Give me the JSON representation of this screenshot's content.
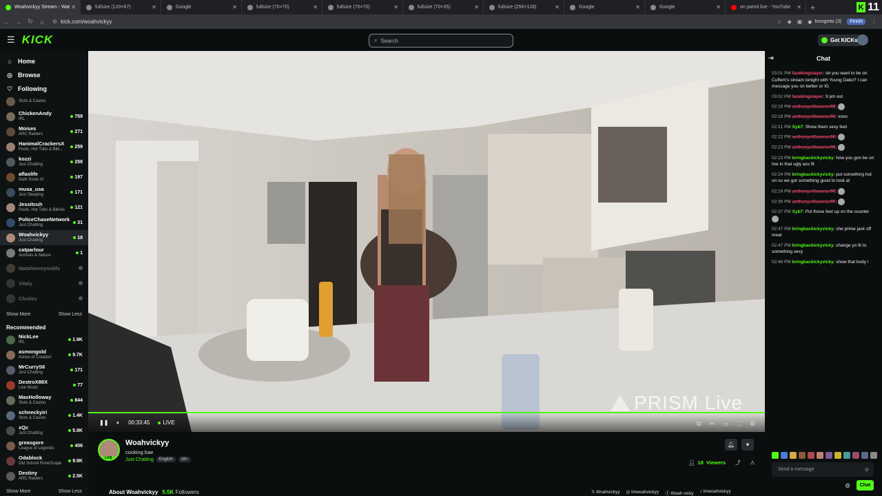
{
  "browser": {
    "tabs": [
      {
        "label": "Woahvickyy Stream - Wat",
        "color": "#53fc18",
        "active": true
      },
      {
        "label": "fullsize (120×67)",
        "color": "#888"
      },
      {
        "label": "Google",
        "color": "#888"
      },
      {
        "label": "fullsize (70×70)",
        "color": "#888"
      },
      {
        "label": "fullsize (70×70)",
        "color": "#888"
      },
      {
        "label": "fullsize (70×35)",
        "color": "#888"
      },
      {
        "label": "fullsize (256×128)",
        "color": "#888"
      },
      {
        "label": "Google",
        "color": "#888"
      },
      {
        "label": "Google",
        "color": "#888"
      },
      {
        "label": "on patrol live - YouTube",
        "color": "#ff0000"
      }
    ],
    "brand_number": "11",
    "url": "kick.com/woahvickyy",
    "incognito_label": "Incognito (3)",
    "finish_label": "Finish"
  },
  "header": {
    "logo": "KICK",
    "search_placeholder": "Search",
    "get_kicks_label": "Get KICKs"
  },
  "sidebar": {
    "nav": [
      {
        "label": "Home",
        "icon": "home-icon"
      },
      {
        "label": "Browse",
        "icon": "compass-icon"
      },
      {
        "label": "Following",
        "icon": "heart-icon"
      }
    ],
    "following": [
      {
        "name": "",
        "category": "Slots & Casino",
        "viewers": "",
        "color": "#6a5a4a"
      },
      {
        "name": "ChickenAndy",
        "category": "IRL",
        "viewers": "759",
        "color": "#7a6a5a"
      },
      {
        "name": "Moises",
        "category": "ARC Raiders",
        "viewers": "271",
        "color": "#5a4a3a"
      },
      {
        "name": "HanimalCrackersX",
        "category": "Pools, Hot Tubs & Biki...",
        "viewers": "259",
        "color": "#9a8070"
      },
      {
        "name": "kozzi",
        "category": "Just Chatting",
        "viewers": "258",
        "color": "#505a60"
      },
      {
        "name": "aflaxlife",
        "category": "Dark Souls III",
        "viewers": "197",
        "color": "#6a4a30"
      },
      {
        "name": "musa_usa",
        "category": "Just Sleeping",
        "viewers": "171",
        "color": "#3a4a5a"
      },
      {
        "name": "Jessitcuh",
        "category": "Pools, Hot Tubs & Bikinis",
        "viewers": "121",
        "color": "#a08878"
      },
      {
        "name": "PoliceChaseNetwork",
        "category": "Just Chatting",
        "viewers": "31",
        "color": "#304a6a"
      },
      {
        "name": "Woahvickyy",
        "category": "Just Chatting",
        "viewers": "18",
        "color": "#b08a78",
        "active": true
      },
      {
        "name": "catparlour",
        "category": "Animals & Nature",
        "viewers": "1",
        "color": "#7a7a7a"
      },
      {
        "name": "Natalieereynolds",
        "category": "",
        "viewers": "",
        "color": "#8a7a6a",
        "offline": true
      },
      {
        "name": "Vitaly",
        "category": "",
        "viewers": "",
        "color": "#6a6a6a",
        "offline": true
      },
      {
        "name": "Cluxles",
        "category": "",
        "viewers": "",
        "color": "#6a6a6a",
        "offline": true
      }
    ],
    "show_more": "Show More",
    "show_less": "Show Less",
    "recommended_title": "Recommended",
    "recommended": [
      {
        "name": "NickLee",
        "category": "IRL",
        "viewers": "1.9K",
        "color": "#4a6a4a"
      },
      {
        "name": "asmongold",
        "category": "Ashes of Creation",
        "viewers": "9.7K",
        "color": "#8a6a5a"
      },
      {
        "name": "MrCurryS6",
        "category": "Just Chatting",
        "viewers": "171",
        "color": "#5a5a6a"
      },
      {
        "name": "DestroX88X",
        "category": "Live Music",
        "viewers": "77",
        "color": "#9a3a2a"
      },
      {
        "name": "MaxHolloway",
        "category": "Slots & Casino",
        "viewers": "844",
        "color": "#6a6a5a"
      },
      {
        "name": "schneckyiri",
        "category": "Slots & Casino",
        "viewers": "1.4K",
        "color": "#5a6a7a"
      },
      {
        "name": "xQc",
        "category": "Just Chatting",
        "viewers": "5.9K",
        "color": "#4a4a4a"
      },
      {
        "name": "greasgore",
        "category": "League of Legends",
        "viewers": "406",
        "color": "#7a5a4a"
      },
      {
        "name": "Odablock",
        "category": "Old School RuneScape",
        "viewers": "9.9K",
        "color": "#6a3a3a"
      },
      {
        "name": "Destiny",
        "category": "ARC Raiders",
        "viewers": "2.5K",
        "color": "#5a5a5a"
      }
    ]
  },
  "player": {
    "time": "00:33:45",
    "live_label": "LIVE",
    "watermark": "PRISM Live"
  },
  "channel": {
    "name": "Woahvickyy",
    "title": "cooking bae",
    "category": "Just Chatting",
    "tags": [
      "English",
      "18+"
    ],
    "live_badge": "LIVE",
    "viewers_count": "18",
    "viewers_label": "Viewers",
    "about_label": "About Woahvickyy",
    "followers": "5.5K",
    "followers_label": "Followers",
    "socials": [
      "Woahvickyy",
      "lmwoahvickyy",
      "Woah vicky",
      "lmwoahvickyy"
    ]
  },
  "chat": {
    "title": "Chat",
    "messages": [
      {
        "time": "03:01 PM",
        "user": "fazekingslayer",
        "color": "#ff4d6d",
        "text": "do you want to be on Cuffem's stream tonight with Young Dabo? I can message you on twitter or IG"
      },
      {
        "time": "03:02 PM",
        "user": "fazekingslayer",
        "color": "#ff4d6d",
        "text": "9 pm est"
      },
      {
        "time": "02:16 PM",
        "user": "anthonyvillasenor90",
        "color": "#ff4d6d",
        "text": "",
        "emote": true
      },
      {
        "time": "02:16 PM",
        "user": "anthonyvillasenor90",
        "color": "#ff4d6d",
        "text": "xoxo"
      },
      {
        "time": "02:21 PM",
        "user": "Syb7",
        "color": "#53fc18",
        "text": "Show them sexy feet"
      },
      {
        "time": "02:22 PM",
        "user": "anthonyvillasenor90",
        "color": "#ff4d6d",
        "text": "",
        "emote": true
      },
      {
        "time": "02:23 PM",
        "user": "anthonyvillasenor90",
        "color": "#ff4d6d",
        "text": "",
        "emote": true
      },
      {
        "time": "02:23 PM",
        "user": "bringbackickyvicky",
        "color": "#53fc18",
        "text": "how you gon be on live in that ugly ass fit"
      },
      {
        "time": "02:24 PM",
        "user": "bringbackickyvicky",
        "color": "#53fc18",
        "text": "put something hot on so we got something good to look at"
      },
      {
        "time": "02:24 PM",
        "user": "anthonyvillasenor90",
        "color": "#ff4d6d",
        "text": "",
        "emote": true
      },
      {
        "time": "02:36 PM",
        "user": "anthonyvillasenor90",
        "color": "#ff4d6d",
        "text": "",
        "emote": true
      },
      {
        "time": "02:37 PM",
        "user": "Syb7",
        "color": "#53fc18",
        "text": "Put those feet up on the counter",
        "emote": true
      },
      {
        "time": "02:47 PM",
        "user": "bringbackickyvicky",
        "color": "#53fc18",
        "text": "she prime jack off meat"
      },
      {
        "time": "02:47 PM",
        "user": "bringbackickyvicky",
        "color": "#53fc18",
        "text": "change yo fit to something sexy"
      },
      {
        "time": "02:48 PM",
        "user": "bringbackickyvicky",
        "color": "#53fc18",
        "text": "show that body !"
      }
    ],
    "input_placeholder": "Send a message",
    "send_label": "Chat"
  }
}
